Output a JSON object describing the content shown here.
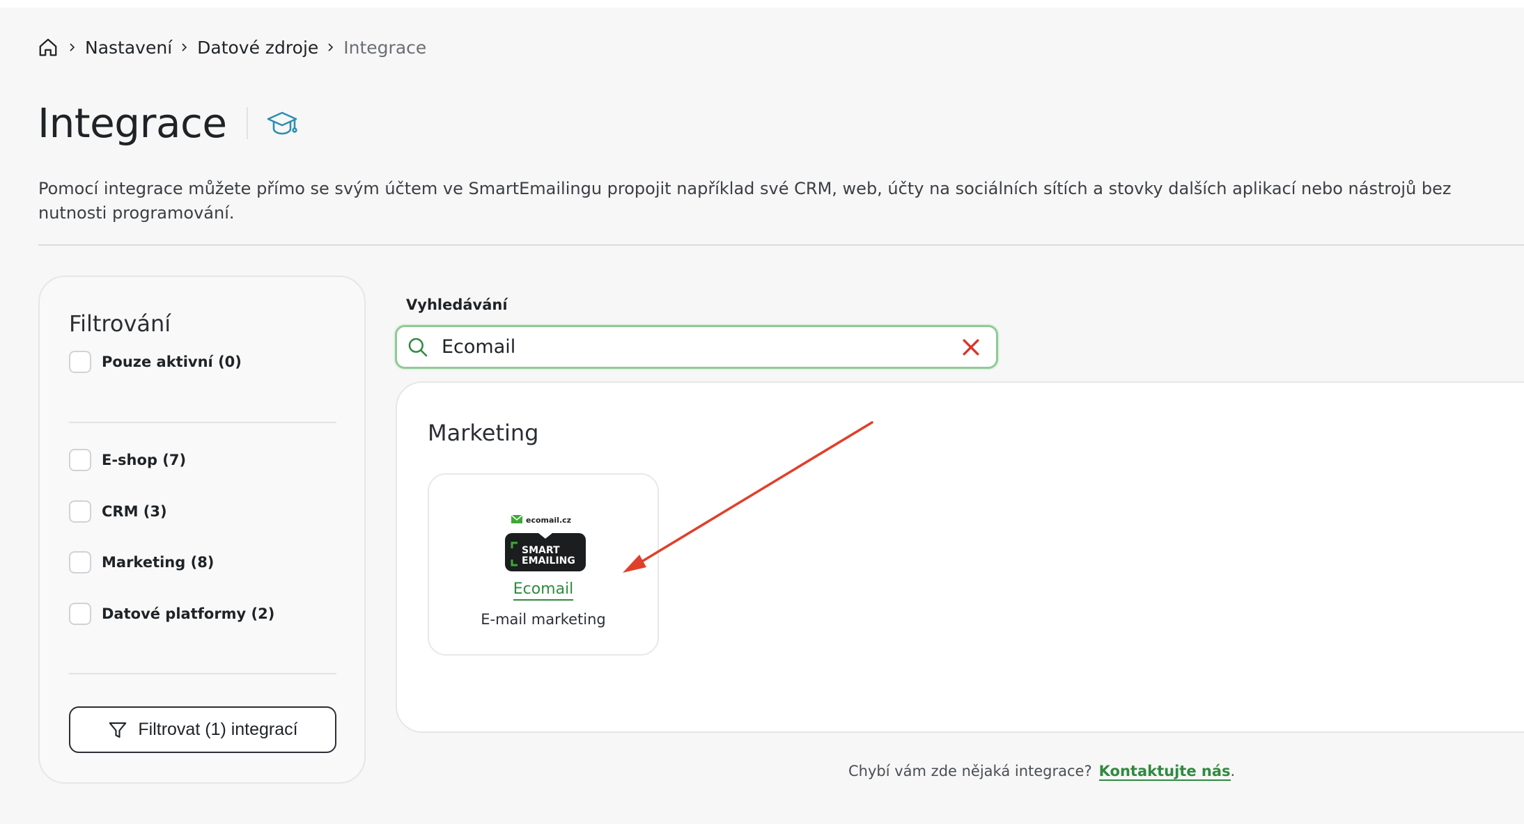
{
  "breadcrumb": {
    "home_icon": "home-icon",
    "items": [
      "Nastavení",
      "Datové zdroje",
      "Integrace"
    ]
  },
  "page": {
    "title": "Integrace",
    "title_icon": "graduation-cap-icon",
    "intro": "Pomocí integrace můžete přímo se svým účtem ve SmartEmailingu propojit například své CRM, web, účty na sociálních sítích a stovky dalších aplikací nebo nástrojů bez nutnosti programování."
  },
  "filter": {
    "title": "Filtrování",
    "only_active": "Pouze aktivní (0)",
    "categories": [
      "E-shop (7)",
      "CRM (3)",
      "Marketing (8)",
      "Datové platformy (2)"
    ],
    "button_label": "Filtrovat (1) integrací",
    "button_icon": "funnel-icon"
  },
  "search": {
    "label": "Vyhledávání",
    "value": "Ecomail",
    "icon": "search-icon",
    "clear_icon": "close-icon"
  },
  "results": {
    "section_title": "Marketing",
    "cards": [
      {
        "logo_text_top": "ecomail.cz",
        "logo_text_smart": "SMART",
        "logo_text_emailing": "EMAILING",
        "name": "Ecomail",
        "description": "E-mail marketing"
      }
    ]
  },
  "footer": {
    "question": "Chybí vám zde nějaká integrace?",
    "link": "Kontaktujte nás",
    "period": "."
  },
  "colors": {
    "accent_green": "#2f8a3f",
    "search_border": "#8fca96",
    "clear_red": "#d8342c",
    "annotation_arrow": "#e0402a",
    "edu_icon_blue": "#2d8fb0"
  }
}
